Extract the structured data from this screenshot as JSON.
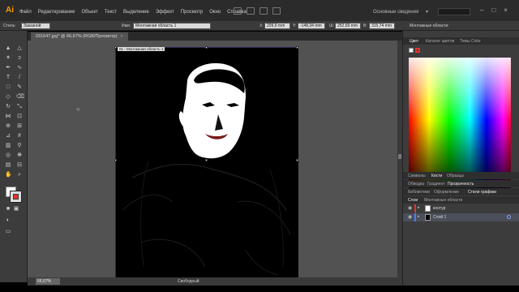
{
  "app": {
    "logo": "Ai",
    "workspace": "Основные сведения"
  },
  "menu": [
    "Файл",
    "Редактирование",
    "Объект",
    "Текст",
    "Выделение",
    "Эффект",
    "Просмотр",
    "Окно",
    "Справка"
  ],
  "control_bar": {
    "style_label": "Стиль:",
    "style_value": "Заказной",
    "name_label": "Имя:",
    "name_value": "Монтажная область 1",
    "x_label": "X:",
    "x_value": "209,9 mm",
    "y_label": "Y:",
    "y_value": "-148,34 mm",
    "w_label": "Ш:",
    "w_value": "252,59 mm",
    "h_label": "В:",
    "h_value": "315,74 mm",
    "artboards_label": "Монтажные области:"
  },
  "document": {
    "tab_title": "031647.jpg* @ 66,67% (RGB/Просмотр)",
    "tab_close": "×",
    "artboard_label": "01 - Монтажная область 1"
  },
  "status": {
    "zoom": "66,67%",
    "tool": "Свободный"
  },
  "panels": {
    "color_tabs": [
      "Цвет",
      "Каталог цветов",
      "Темы Color"
    ],
    "swatch_tabs": [
      "Символы",
      "Кисти",
      "Образцы"
    ],
    "transparency_tabs": [
      "Обводка",
      "Градиент",
      "Прозрачность"
    ],
    "appearance_tabs": [
      "Библиотеки",
      "Оформление",
      "Стили графики"
    ],
    "layers_tabs": [
      "Слои",
      "Монтажные области"
    ],
    "layers": [
      {
        "name": "контур",
        "color": "#e63232"
      },
      {
        "name": "Слой 1",
        "color": "#4d7fff"
      }
    ]
  },
  "colors": {
    "accent": "#ff9a00",
    "panel_bg": "#3c3c3c",
    "canvas_bg": "#525252"
  }
}
